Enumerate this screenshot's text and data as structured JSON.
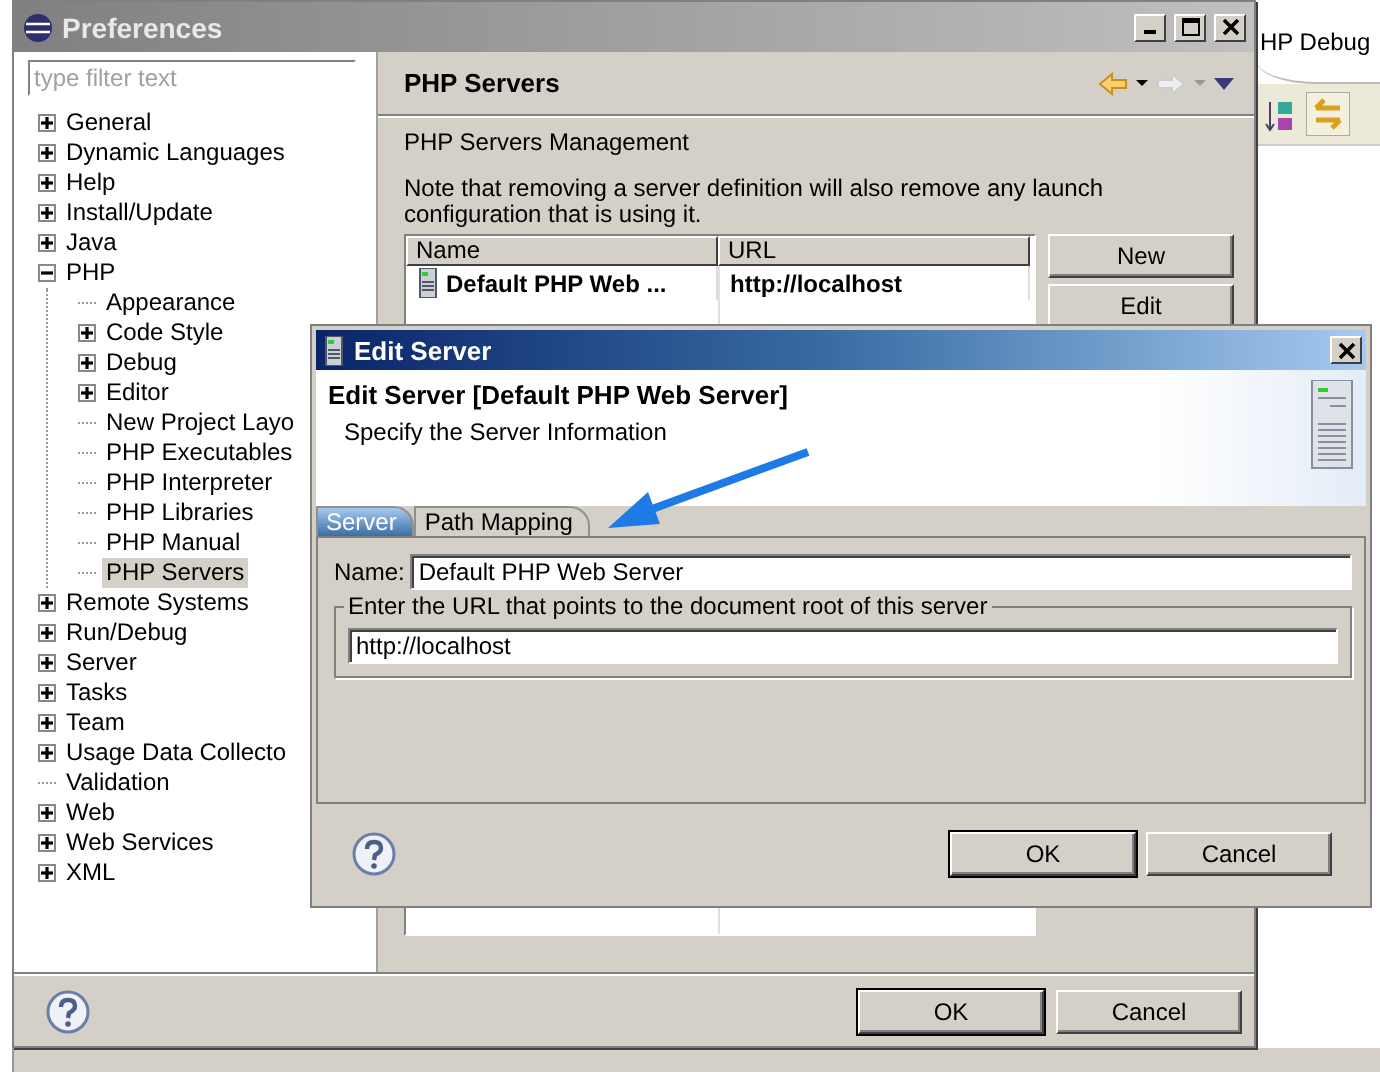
{
  "workbench": {
    "perspective_tab": "HP Debug"
  },
  "preferences": {
    "title": "Preferences",
    "filter": {
      "placeholder": "type filter text"
    },
    "tree": [
      {
        "label": "General",
        "kind": "folder",
        "expanded": false,
        "selected": false
      },
      {
        "label": "Dynamic Languages",
        "kind": "folder",
        "expanded": false,
        "selected": false
      },
      {
        "label": "Help",
        "kind": "folder",
        "expanded": false,
        "selected": false
      },
      {
        "label": "Install/Update",
        "kind": "folder",
        "expanded": false,
        "selected": false
      },
      {
        "label": "Java",
        "kind": "folder",
        "expanded": false,
        "selected": false
      },
      {
        "label": "PHP",
        "kind": "folder",
        "expanded": true,
        "selected": false,
        "children": [
          {
            "label": "Appearance",
            "kind": "leaf",
            "selected": false
          },
          {
            "label": "Code Style",
            "kind": "folder",
            "expanded": false,
            "selected": false
          },
          {
            "label": "Debug",
            "kind": "folder",
            "expanded": false,
            "selected": false
          },
          {
            "label": "Editor",
            "kind": "folder",
            "expanded": false,
            "selected": false
          },
          {
            "label": "New Project Layo",
            "kind": "leaf",
            "selected": false
          },
          {
            "label": "PHP Executables",
            "kind": "leaf",
            "selected": false
          },
          {
            "label": "PHP Interpreter",
            "kind": "leaf",
            "selected": false
          },
          {
            "label": "PHP Libraries",
            "kind": "leaf",
            "selected": false
          },
          {
            "label": "PHP Manual",
            "kind": "leaf",
            "selected": false
          },
          {
            "label": "PHP Servers",
            "kind": "leaf",
            "selected": true
          }
        ]
      },
      {
        "label": "Remote Systems",
        "kind": "folder",
        "expanded": false,
        "selected": false
      },
      {
        "label": "Run/Debug",
        "kind": "folder",
        "expanded": false,
        "selected": false
      },
      {
        "label": "Server",
        "kind": "folder",
        "expanded": false,
        "selected": false
      },
      {
        "label": "Tasks",
        "kind": "folder",
        "expanded": false,
        "selected": false
      },
      {
        "label": "Team",
        "kind": "folder",
        "expanded": false,
        "selected": false
      },
      {
        "label": "Usage Data Collecto",
        "kind": "folder",
        "expanded": false,
        "selected": false
      },
      {
        "label": "Validation",
        "kind": "leaf",
        "selected": false
      },
      {
        "label": "Web",
        "kind": "folder",
        "expanded": false,
        "selected": false
      },
      {
        "label": "Web Services",
        "kind": "folder",
        "expanded": false,
        "selected": false
      },
      {
        "label": "XML",
        "kind": "folder",
        "expanded": false,
        "selected": false
      }
    ],
    "page": {
      "title": "PHP Servers",
      "description": "PHP Servers Management",
      "note": "Note that removing a server definition will also remove any launch configuration that is using it.",
      "table": {
        "columns": [
          "Name",
          "URL"
        ],
        "rows": [
          {
            "name": "Default PHP Web ...",
            "url": "http://localhost"
          }
        ]
      },
      "side_buttons": [
        "New",
        "Edit"
      ]
    },
    "buttons": [
      "OK",
      "Cancel"
    ]
  },
  "edit_server": {
    "title": "Edit Server",
    "heading": "Edit Server [Default PHP Web Server]",
    "subtitle": "Specify the Server Information",
    "tabs": [
      {
        "label": "Server",
        "selected": true
      },
      {
        "label": "Path Mapping",
        "selected": false
      }
    ],
    "name_label": "Name:",
    "name_value": "Default PHP Web Server",
    "url_group_label": "Enter the URL that points to the document root of this server",
    "url_value": "http://localhost",
    "buttons": [
      "OK",
      "Cancel"
    ]
  }
}
